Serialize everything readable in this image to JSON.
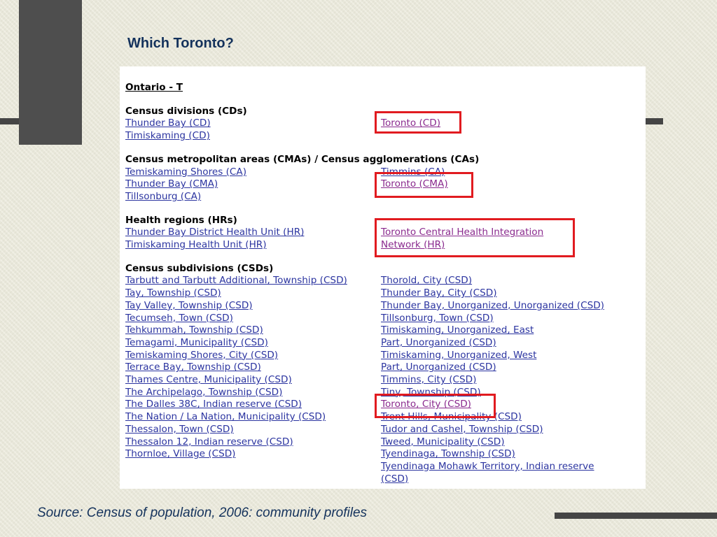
{
  "slide": {
    "title": "Which Toronto?",
    "source": "Source: Census of population, 2006: community profiles"
  },
  "panel": {
    "letter_heading": "Ontario - T",
    "sections": [
      {
        "heading": "Census divisions (CDs)",
        "left": [
          "Thunder Bay (CD)",
          "Timiskaming (CD)"
        ],
        "right": [
          "Toronto (CD)"
        ]
      },
      {
        "heading": "Census metropolitan areas (CMAs) / Census agglomerations (CAs)",
        "left": [
          "Temiskaming Shores (CA)",
          "Thunder Bay (CMA)",
          "Tillsonburg (CA)"
        ],
        "right": [
          "Timmins (CA)",
          "Toronto (CMA)"
        ]
      },
      {
        "heading": "Health regions (HRs)",
        "left": [
          "Thunder Bay District Health Unit (HR)",
          "Timiskaming Health Unit (HR)"
        ],
        "right": [
          "Toronto Central Health Integration",
          "Network (HR)"
        ]
      },
      {
        "heading": "Census subdivisions (CSDs)",
        "left": [
          "Tarbutt and Tarbutt Additional, Township (CSD)",
          "Tay, Township (CSD)",
          "Tay Valley, Township (CSD)",
          "Tecumseh, Town (CSD)",
          "Tehkummah, Township (CSD)",
          "Temagami, Municipality (CSD)",
          "Temiskaming Shores, City (CSD)",
          "Terrace Bay, Township (CSD)",
          "Thames Centre, Municipality (CSD)",
          "The Archipelago, Township (CSD)",
          "The Dalles 38C, Indian reserve (CSD)",
          "The Nation / La Nation, Municipality (CSD)",
          "Thessalon, Town (CSD)",
          "Thessalon 12, Indian reserve (CSD)",
          "Thornloe, Village (CSD)"
        ],
        "right": [
          "Thorold, City (CSD)",
          "Thunder Bay, City (CSD)",
          "Thunder Bay, Unorganized, Unorganized (CSD)",
          "Tillsonburg, Town (CSD)",
          "Timiskaming, Unorganized, East",
          "Part, Unorganized (CSD)",
          "Timiskaming, Unorganized, West",
          "Part, Unorganized (CSD)",
          "Timmins, City (CSD)",
          "Tiny, Township (CSD)",
          "Toronto, City (CSD)",
          "Trent Hills, Municipality (CSD)",
          "Tudor and Cashel, Township (CSD)",
          "Tweed, Municipality (CSD)",
          "Tyendinaga, Township (CSD)",
          "Tyendinaga Mohawk Territory, Indian reserve",
          "(CSD)"
        ]
      }
    ]
  },
  "colors": {
    "title": "#14325c",
    "link": "#2b34a0",
    "visited_link": "#8a2a8e",
    "highlight": "#e11b20",
    "dark_bar": "#4e4e4e"
  }
}
